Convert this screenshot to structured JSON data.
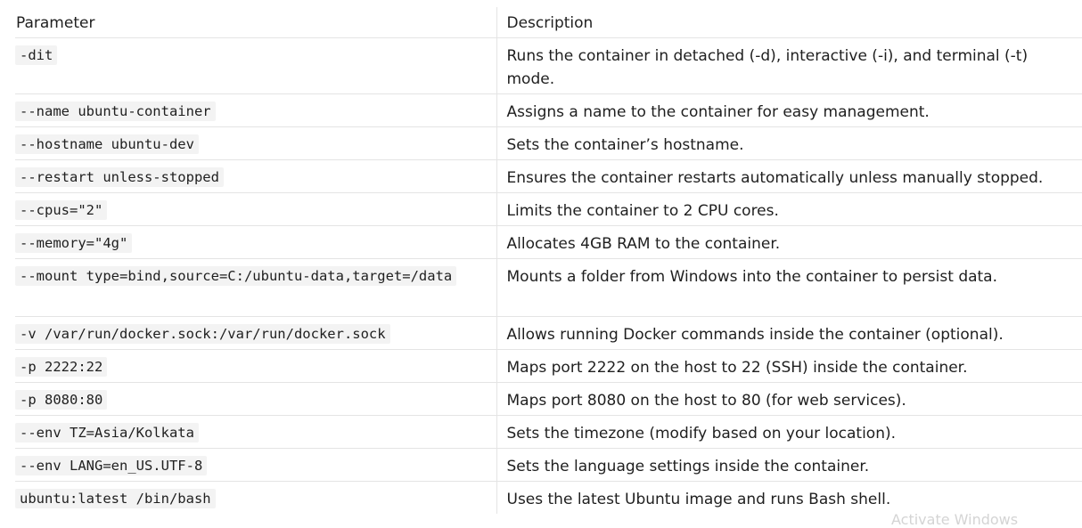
{
  "table": {
    "headers": {
      "parameter": "Parameter",
      "description": "Description"
    },
    "rows": [
      {
        "param": "-dit",
        "desc": "Runs the container in detached (-d), interactive (-i), and terminal (-t) mode."
      },
      {
        "param": "--name ubuntu-container",
        "desc": "Assigns a name to the container for easy management."
      },
      {
        "param": "--hostname ubuntu-dev",
        "desc": "Sets the container’s hostname."
      },
      {
        "param": "--restart unless-stopped",
        "desc": "Ensures the container restarts automatically unless manually stopped."
      },
      {
        "param": "--cpus=\"2\"",
        "desc": "Limits the container to 2 CPU cores."
      },
      {
        "param": "--memory=\"4g\"",
        "desc": "Allocates 4GB RAM to the container."
      },
      {
        "param": "--mount type=bind,source=C:/ubuntu-data,target=/data",
        "desc": "Mounts a folder from Windows into the container to persist data."
      },
      {
        "param": "-v /var/run/docker.sock:/var/run/docker.sock",
        "desc": "Allows running Docker commands inside the container (optional)."
      },
      {
        "param": "-p 2222:22",
        "desc": "Maps port 2222 on the host to 22 (SSH) inside the container."
      },
      {
        "param": "-p 8080:80",
        "desc": "Maps port 8080 on the host to 80 (for web services)."
      },
      {
        "param": "--env TZ=Asia/Kolkata",
        "desc": "Sets the timezone (modify based on your location)."
      },
      {
        "param": "--env LANG=en_US.UTF-8",
        "desc": "Sets the language settings inside the container."
      },
      {
        "param": "ubuntu:latest /bin/bash",
        "desc": "Uses the latest Ubuntu image and runs Bash shell."
      }
    ]
  },
  "watermark": "Activate Windows"
}
